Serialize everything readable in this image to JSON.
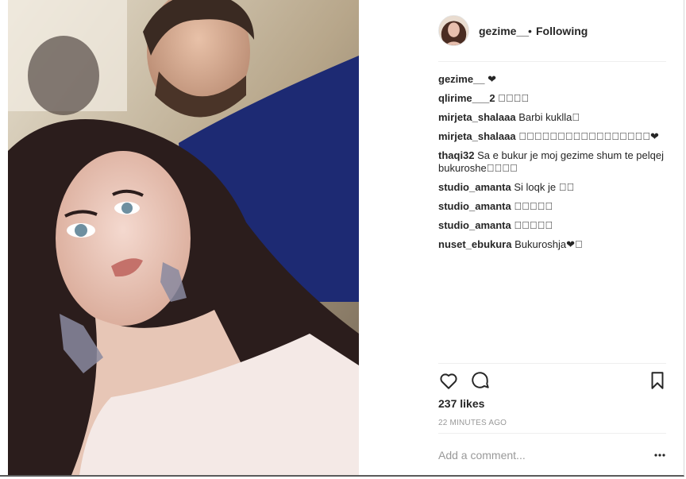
{
  "post": {
    "username": "gezime__",
    "separator": "•",
    "follow_status": "Following"
  },
  "comments": [
    {
      "user": "gezime__",
      "text": "❤"
    },
    {
      "user": "qlirime___2",
      "text": "􀀀􀀀􀀀􀀀"
    },
    {
      "user": "mirjeta_shalaaa",
      "text": "Barbi kuklla􀀀"
    },
    {
      "user": "mirjeta_shalaaa",
      "text": "􀀀􀀀􀀀􀀀􀀀􀀀􀀀􀀀􀀀􀀀􀀀􀀀􀀀􀀀􀀀􀀀􀀀❤"
    },
    {
      "user": "thaqi32",
      "text": "Sa e bukur je moj gezime shum te pelqej bukuroshe􀀀􀀀􀀀􀀀"
    },
    {
      "user": "studio_amanta",
      "text": "Si loqk je 􀀀􀀀"
    },
    {
      "user": "studio_amanta",
      "text": "􀀀􀀀􀀀􀀀􀀀"
    },
    {
      "user": "studio_amanta",
      "text": "􀀀􀀀􀀀􀀀􀀀"
    },
    {
      "user": "nuset_ebukura",
      "text": "Bukuroshja❤􀀀"
    }
  ],
  "likes_text": "237 likes",
  "timestamp": "22 MINUTES AGO",
  "comment_box": {
    "placeholder": "Add a comment..."
  },
  "icons": {
    "like": "heart-icon",
    "comment": "speech-bubble-icon",
    "save": "bookmark-icon",
    "more": "more-options-icon"
  }
}
